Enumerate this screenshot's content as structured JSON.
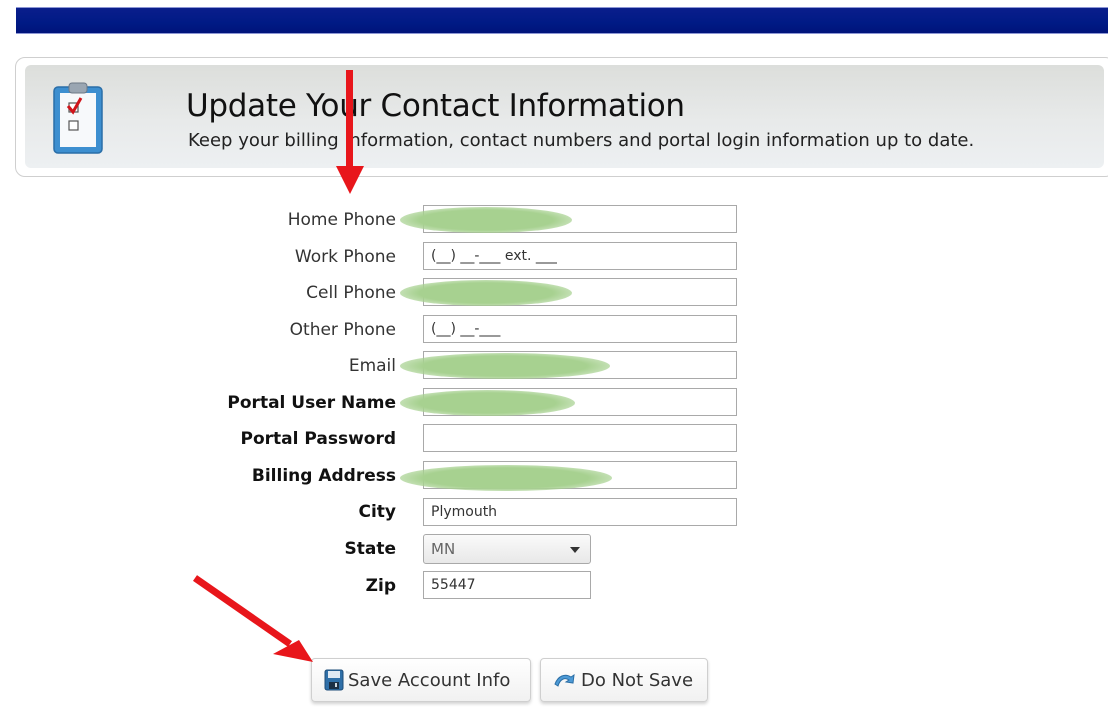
{
  "header": {
    "title": "Update Your Contact Information",
    "subtitle": "Keep your billing information, contact numbers and portal login information up to date.",
    "icon": "clipboard-checklist-icon"
  },
  "form": {
    "fields": [
      {
        "label": "Home Phone",
        "value": "",
        "redacted": true,
        "bold": false
      },
      {
        "label": "Work Phone",
        "value": "(__) __-___ ext. ___",
        "redacted": false,
        "bold": false
      },
      {
        "label": "Cell Phone",
        "value": "",
        "redacted": true,
        "bold": false
      },
      {
        "label": "Other Phone",
        "value": "(__) __-___",
        "redacted": false,
        "bold": false
      },
      {
        "label": "Email",
        "value": "",
        "redacted": true,
        "bold": false
      },
      {
        "label": "Portal User Name",
        "value": "",
        "redacted": true,
        "bold": true
      },
      {
        "label": "Portal Password",
        "value": "",
        "redacted": false,
        "bold": true
      },
      {
        "label": "Billing Address",
        "value": "",
        "redacted": true,
        "bold": true
      },
      {
        "label": "City",
        "value": "Plymouth",
        "redacted": false,
        "bold": true
      }
    ],
    "state": {
      "label": "State",
      "value": "MN"
    },
    "zip": {
      "label": "Zip",
      "value": "55447"
    }
  },
  "buttons": {
    "save": {
      "label": "Save Account Info",
      "icon": "floppy-disk-icon"
    },
    "cancel": {
      "label": "Do Not Save",
      "icon": "undo-arrow-icon"
    }
  },
  "colors": {
    "topbar": "#001a85",
    "annotation_arrow": "#e8161b",
    "redaction": "#a7d190"
  }
}
